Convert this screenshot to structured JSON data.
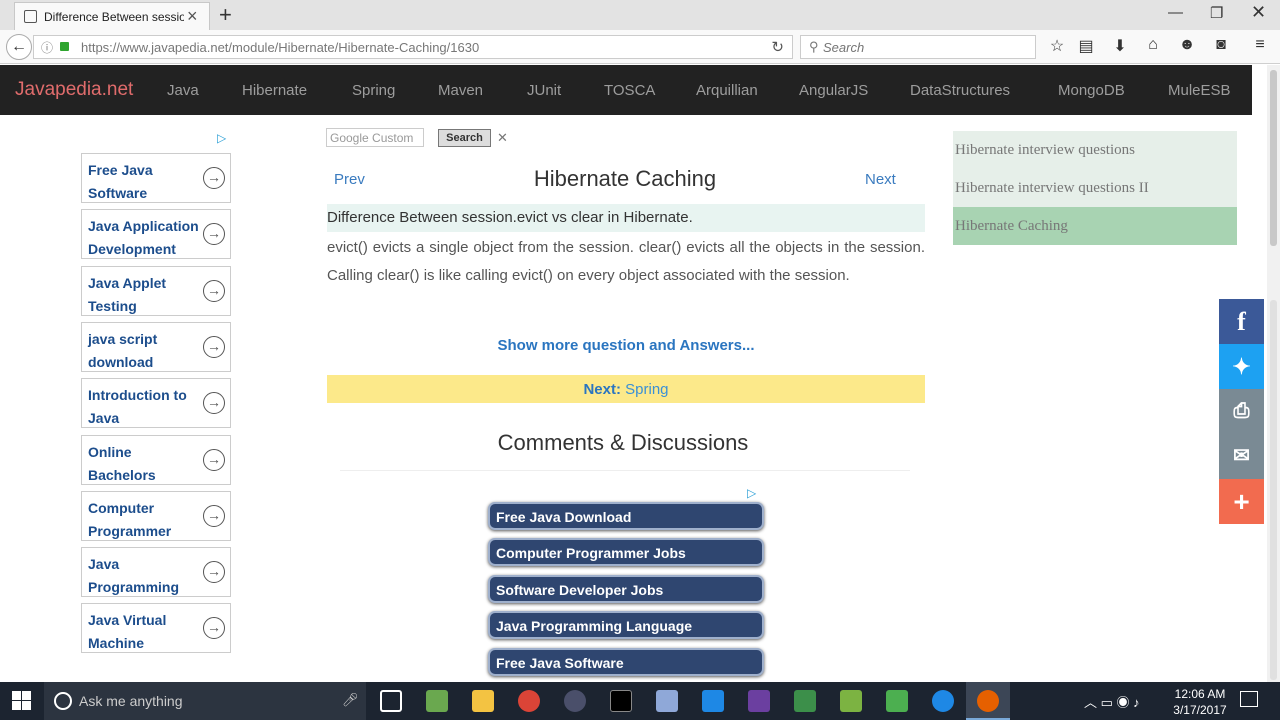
{
  "browser": {
    "tab_title": "Difference Between sessio...",
    "url_domain": "https://www.javapedia.net",
    "url_path": "/module/Hibernate/Hibernate-Caching/1630",
    "search_placeholder": "Search"
  },
  "site": {
    "logo": "Javapedia.net",
    "nav": [
      "Java",
      "Hibernate",
      "Spring",
      "Maven",
      "JUnit",
      "TOSCA",
      "Arquillian",
      "AngularJS",
      "DataStructures",
      "MongoDB",
      "MuleESB"
    ]
  },
  "left_ads": [
    "Free Java Software",
    "Java Application Development",
    "Java Applet Testing",
    "java script download",
    "Introduction to Java",
    "Online Bachelors",
    "Computer Programmer",
    "Java Programming",
    "Java Virtual Machine"
  ],
  "main": {
    "google_search_value": "Google  Custom",
    "search_button": "Search",
    "prev": "Prev",
    "next": "Next",
    "title": "Hibernate Caching",
    "question": "Difference Between session.evict vs clear in Hibernate.",
    "answer": "evict() evicts a single object from the session. clear() evicts all the objects in the session. Calling clear() is like calling evict() on every object associated with the session.",
    "show_more": "Show more question and Answers...",
    "next_label": "Next:",
    "next_link": "Spring",
    "comments_heading": "Comments & Discussions"
  },
  "bottom_ads": [
    "Free Java Download",
    "Computer Programmer Jobs",
    "Software Developer Jobs",
    "Java Programming Language",
    "Free Java Software"
  ],
  "sidebar": [
    {
      "label": "Hibernate interview questions",
      "active": false
    },
    {
      "label": "Hibernate interview questions II",
      "active": false
    },
    {
      "label": "Hibernate Caching",
      "active": true
    }
  ],
  "social": [
    {
      "name": "facebook-icon",
      "glyph": "f",
      "color": "#3b5998"
    },
    {
      "name": "twitter-icon",
      "glyph": "t",
      "color": "#1da1f2"
    },
    {
      "name": "print-icon",
      "glyph": "⎙",
      "color": "#7a8a94"
    },
    {
      "name": "email-icon",
      "glyph": "✉",
      "color": "#7a8a94"
    },
    {
      "name": "more-icon",
      "glyph": "+",
      "color": "#f26b4f"
    }
  ],
  "taskbar": {
    "search_text": "Ask me anything",
    "time": "12:06 AM",
    "date": "3/17/2017"
  }
}
